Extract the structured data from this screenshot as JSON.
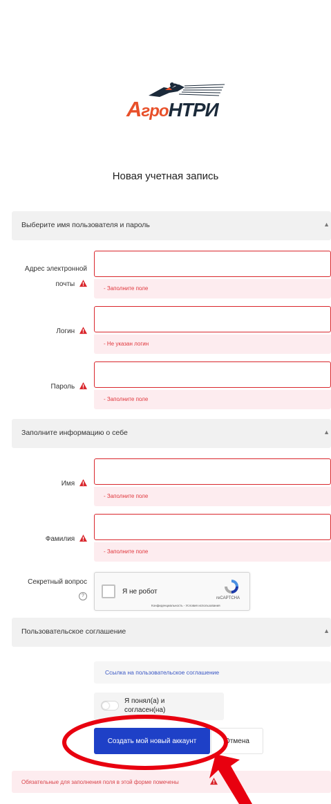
{
  "brand": {
    "logo_part1": "А",
    "logo_part2": "гро",
    "logo_part3": "НТРИ"
  },
  "page_title": "Новая учетная запись",
  "sections": {
    "credentials": "Выберите имя пользователя и пароль",
    "about": "Заполните информацию о себе",
    "agreement": "Пользовательское соглашение",
    "chevron": "▲"
  },
  "fields": {
    "email": {
      "label_line1": "Адрес электронной",
      "label_line2": "почты",
      "value": "",
      "error": "- Заполните поле"
    },
    "login": {
      "label": "Логин",
      "value": "",
      "error": "- Не указан логин"
    },
    "password": {
      "label": "Пароль",
      "value": "",
      "error": "- Заполните поле"
    },
    "first_name": {
      "label": "Имя",
      "value": "",
      "error": "- Заполните поле"
    },
    "last_name": {
      "label": "Фамилия",
      "value": "",
      "error": "- Заполните поле"
    },
    "secret": {
      "label": "Секретный вопрос",
      "help": "?"
    }
  },
  "captcha": {
    "checkbox_label": "Я не робот",
    "brand": "reCAPTCHA",
    "terms": "Конфиденциальность - Условия использования"
  },
  "agreement": {
    "link_text": "Ссылка на пользовательское соглашение",
    "consent_line1": "Я понял(а) и",
    "consent_line2": "согласен(на)"
  },
  "buttons": {
    "submit": "Создать мой новый аккаунт",
    "cancel": "Отмена"
  },
  "footer_note": "Обязательные для заполнения поля в этой форме помечены",
  "colors": {
    "accent": "#1e40c7",
    "error": "#d9252b",
    "error_bg": "#fdecef",
    "annotation": "#e8000f"
  },
  "icons": {
    "warning": "warning-icon",
    "help": "question-circle-icon",
    "recaptcha": "recaptcha-icon"
  }
}
